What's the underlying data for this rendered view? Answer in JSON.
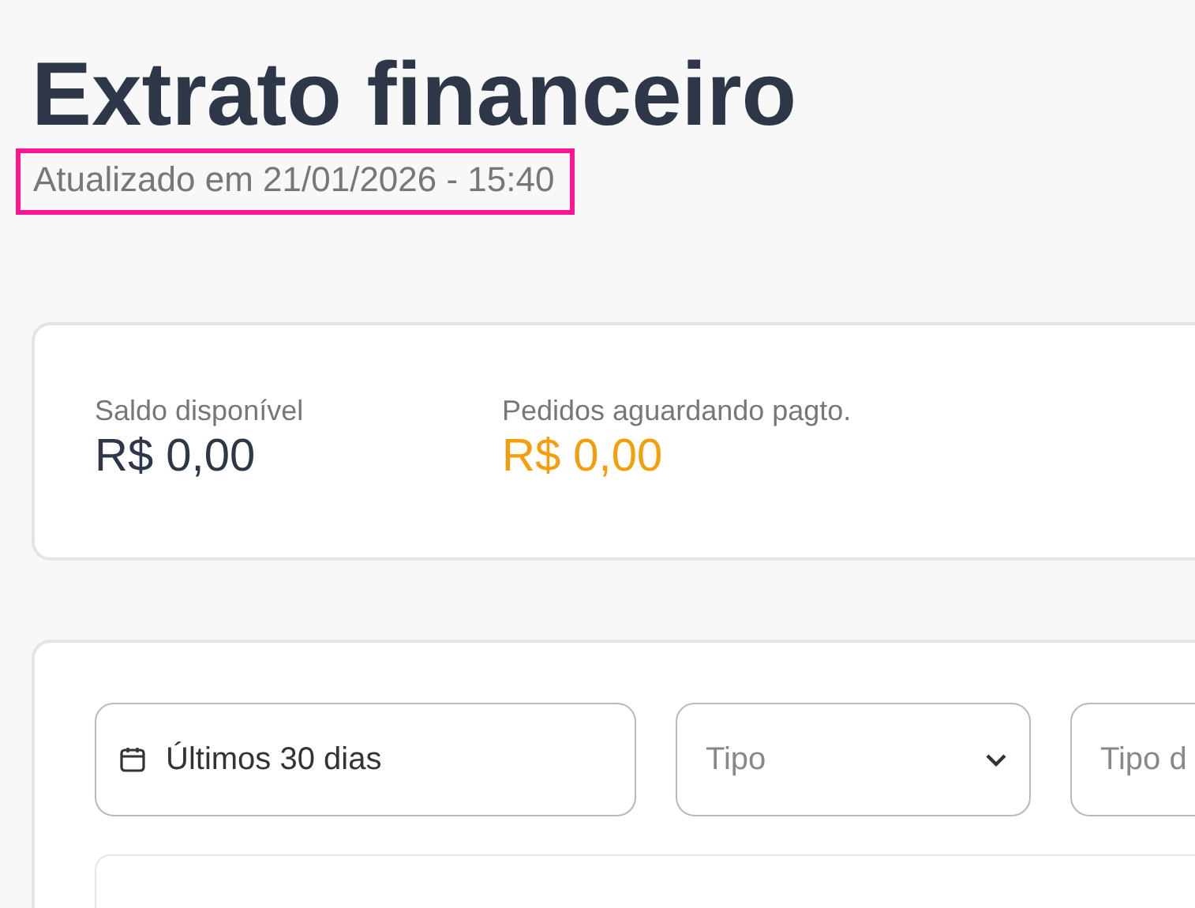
{
  "page": {
    "title": "Extrato financeiro",
    "updated": "Atualizado em 21/01/2026 - 15:40"
  },
  "balances": [
    {
      "label": "Saldo disponível",
      "value": "R$ 0,00",
      "color": "#2d3748"
    },
    {
      "label": "Pedidos aguardando pagto.",
      "value": "R$ 0,00",
      "color": "#f59e0b"
    }
  ],
  "filters": {
    "period": {
      "value": "Últimos 30 dias"
    },
    "type": {
      "placeholder": "Tipo"
    },
    "field_3": {
      "placeholder": "Tipo d"
    }
  }
}
